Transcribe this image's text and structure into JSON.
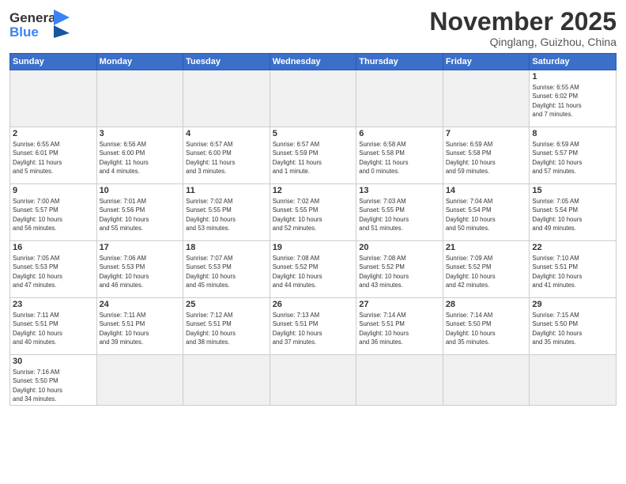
{
  "header": {
    "logo_line1": "General",
    "logo_line2": "Blue",
    "month_title": "November 2025",
    "location": "Qinglang, Guizhou, China"
  },
  "weekdays": [
    "Sunday",
    "Monday",
    "Tuesday",
    "Wednesday",
    "Thursday",
    "Friday",
    "Saturday"
  ],
  "weeks": [
    [
      {
        "day": "",
        "info": ""
      },
      {
        "day": "",
        "info": ""
      },
      {
        "day": "",
        "info": ""
      },
      {
        "day": "",
        "info": ""
      },
      {
        "day": "",
        "info": ""
      },
      {
        "day": "",
        "info": ""
      },
      {
        "day": "1",
        "info": "Sunrise: 6:55 AM\nSunset: 6:02 PM\nDaylight: 11 hours\nand 7 minutes."
      }
    ],
    [
      {
        "day": "2",
        "info": "Sunrise: 6:55 AM\nSunset: 6:01 PM\nDaylight: 11 hours\nand 5 minutes."
      },
      {
        "day": "3",
        "info": "Sunrise: 6:56 AM\nSunset: 6:00 PM\nDaylight: 11 hours\nand 4 minutes."
      },
      {
        "day": "4",
        "info": "Sunrise: 6:57 AM\nSunset: 6:00 PM\nDaylight: 11 hours\nand 3 minutes."
      },
      {
        "day": "5",
        "info": "Sunrise: 6:57 AM\nSunset: 5:59 PM\nDaylight: 11 hours\nand 1 minute."
      },
      {
        "day": "6",
        "info": "Sunrise: 6:58 AM\nSunset: 5:58 PM\nDaylight: 11 hours\nand 0 minutes."
      },
      {
        "day": "7",
        "info": "Sunrise: 6:59 AM\nSunset: 5:58 PM\nDaylight: 10 hours\nand 59 minutes."
      },
      {
        "day": "8",
        "info": "Sunrise: 6:59 AM\nSunset: 5:57 PM\nDaylight: 10 hours\nand 57 minutes."
      }
    ],
    [
      {
        "day": "9",
        "info": "Sunrise: 7:00 AM\nSunset: 5:57 PM\nDaylight: 10 hours\nand 56 minutes."
      },
      {
        "day": "10",
        "info": "Sunrise: 7:01 AM\nSunset: 5:56 PM\nDaylight: 10 hours\nand 55 minutes."
      },
      {
        "day": "11",
        "info": "Sunrise: 7:02 AM\nSunset: 5:55 PM\nDaylight: 10 hours\nand 53 minutes."
      },
      {
        "day": "12",
        "info": "Sunrise: 7:02 AM\nSunset: 5:55 PM\nDaylight: 10 hours\nand 52 minutes."
      },
      {
        "day": "13",
        "info": "Sunrise: 7:03 AM\nSunset: 5:55 PM\nDaylight: 10 hours\nand 51 minutes."
      },
      {
        "day": "14",
        "info": "Sunrise: 7:04 AM\nSunset: 5:54 PM\nDaylight: 10 hours\nand 50 minutes."
      },
      {
        "day": "15",
        "info": "Sunrise: 7:05 AM\nSunset: 5:54 PM\nDaylight: 10 hours\nand 49 minutes."
      }
    ],
    [
      {
        "day": "16",
        "info": "Sunrise: 7:05 AM\nSunset: 5:53 PM\nDaylight: 10 hours\nand 47 minutes."
      },
      {
        "day": "17",
        "info": "Sunrise: 7:06 AM\nSunset: 5:53 PM\nDaylight: 10 hours\nand 46 minutes."
      },
      {
        "day": "18",
        "info": "Sunrise: 7:07 AM\nSunset: 5:53 PM\nDaylight: 10 hours\nand 45 minutes."
      },
      {
        "day": "19",
        "info": "Sunrise: 7:08 AM\nSunset: 5:52 PM\nDaylight: 10 hours\nand 44 minutes."
      },
      {
        "day": "20",
        "info": "Sunrise: 7:08 AM\nSunset: 5:52 PM\nDaylight: 10 hours\nand 43 minutes."
      },
      {
        "day": "21",
        "info": "Sunrise: 7:09 AM\nSunset: 5:52 PM\nDaylight: 10 hours\nand 42 minutes."
      },
      {
        "day": "22",
        "info": "Sunrise: 7:10 AM\nSunset: 5:51 PM\nDaylight: 10 hours\nand 41 minutes."
      }
    ],
    [
      {
        "day": "23",
        "info": "Sunrise: 7:11 AM\nSunset: 5:51 PM\nDaylight: 10 hours\nand 40 minutes."
      },
      {
        "day": "24",
        "info": "Sunrise: 7:11 AM\nSunset: 5:51 PM\nDaylight: 10 hours\nand 39 minutes."
      },
      {
        "day": "25",
        "info": "Sunrise: 7:12 AM\nSunset: 5:51 PM\nDaylight: 10 hours\nand 38 minutes."
      },
      {
        "day": "26",
        "info": "Sunrise: 7:13 AM\nSunset: 5:51 PM\nDaylight: 10 hours\nand 37 minutes."
      },
      {
        "day": "27",
        "info": "Sunrise: 7:14 AM\nSunset: 5:51 PM\nDaylight: 10 hours\nand 36 minutes."
      },
      {
        "day": "28",
        "info": "Sunrise: 7:14 AM\nSunset: 5:50 PM\nDaylight: 10 hours\nand 35 minutes."
      },
      {
        "day": "29",
        "info": "Sunrise: 7:15 AM\nSunset: 5:50 PM\nDaylight: 10 hours\nand 35 minutes."
      }
    ],
    [
      {
        "day": "30",
        "info": "Sunrise: 7:16 AM\nSunset: 5:50 PM\nDaylight: 10 hours\nand 34 minutes."
      },
      {
        "day": "",
        "info": ""
      },
      {
        "day": "",
        "info": ""
      },
      {
        "day": "",
        "info": ""
      },
      {
        "day": "",
        "info": ""
      },
      {
        "day": "",
        "info": ""
      },
      {
        "day": "",
        "info": ""
      }
    ]
  ]
}
